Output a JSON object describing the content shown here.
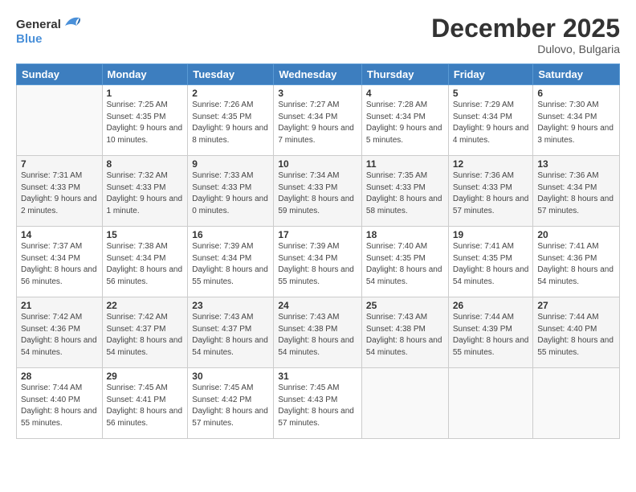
{
  "header": {
    "logo_general": "General",
    "logo_blue": "Blue",
    "month": "December 2025",
    "location": "Dulovo, Bulgaria"
  },
  "weekdays": [
    "Sunday",
    "Monday",
    "Tuesday",
    "Wednesday",
    "Thursday",
    "Friday",
    "Saturday"
  ],
  "weeks": [
    [
      {
        "day": "",
        "sunrise": "",
        "sunset": "",
        "daylight": ""
      },
      {
        "day": "1",
        "sunrise": "Sunrise: 7:25 AM",
        "sunset": "Sunset: 4:35 PM",
        "daylight": "Daylight: 9 hours and 10 minutes."
      },
      {
        "day": "2",
        "sunrise": "Sunrise: 7:26 AM",
        "sunset": "Sunset: 4:35 PM",
        "daylight": "Daylight: 9 hours and 8 minutes."
      },
      {
        "day": "3",
        "sunrise": "Sunrise: 7:27 AM",
        "sunset": "Sunset: 4:34 PM",
        "daylight": "Daylight: 9 hours and 7 minutes."
      },
      {
        "day": "4",
        "sunrise": "Sunrise: 7:28 AM",
        "sunset": "Sunset: 4:34 PM",
        "daylight": "Daylight: 9 hours and 5 minutes."
      },
      {
        "day": "5",
        "sunrise": "Sunrise: 7:29 AM",
        "sunset": "Sunset: 4:34 PM",
        "daylight": "Daylight: 9 hours and 4 minutes."
      },
      {
        "day": "6",
        "sunrise": "Sunrise: 7:30 AM",
        "sunset": "Sunset: 4:34 PM",
        "daylight": "Daylight: 9 hours and 3 minutes."
      }
    ],
    [
      {
        "day": "7",
        "sunrise": "Sunrise: 7:31 AM",
        "sunset": "Sunset: 4:33 PM",
        "daylight": "Daylight: 9 hours and 2 minutes."
      },
      {
        "day": "8",
        "sunrise": "Sunrise: 7:32 AM",
        "sunset": "Sunset: 4:33 PM",
        "daylight": "Daylight: 9 hours and 1 minute."
      },
      {
        "day": "9",
        "sunrise": "Sunrise: 7:33 AM",
        "sunset": "Sunset: 4:33 PM",
        "daylight": "Daylight: 9 hours and 0 minutes."
      },
      {
        "day": "10",
        "sunrise": "Sunrise: 7:34 AM",
        "sunset": "Sunset: 4:33 PM",
        "daylight": "Daylight: 8 hours and 59 minutes."
      },
      {
        "day": "11",
        "sunrise": "Sunrise: 7:35 AM",
        "sunset": "Sunset: 4:33 PM",
        "daylight": "Daylight: 8 hours and 58 minutes."
      },
      {
        "day": "12",
        "sunrise": "Sunrise: 7:36 AM",
        "sunset": "Sunset: 4:33 PM",
        "daylight": "Daylight: 8 hours and 57 minutes."
      },
      {
        "day": "13",
        "sunrise": "Sunrise: 7:36 AM",
        "sunset": "Sunset: 4:34 PM",
        "daylight": "Daylight: 8 hours and 57 minutes."
      }
    ],
    [
      {
        "day": "14",
        "sunrise": "Sunrise: 7:37 AM",
        "sunset": "Sunset: 4:34 PM",
        "daylight": "Daylight: 8 hours and 56 minutes."
      },
      {
        "day": "15",
        "sunrise": "Sunrise: 7:38 AM",
        "sunset": "Sunset: 4:34 PM",
        "daylight": "Daylight: 8 hours and 56 minutes."
      },
      {
        "day": "16",
        "sunrise": "Sunrise: 7:39 AM",
        "sunset": "Sunset: 4:34 PM",
        "daylight": "Daylight: 8 hours and 55 minutes."
      },
      {
        "day": "17",
        "sunrise": "Sunrise: 7:39 AM",
        "sunset": "Sunset: 4:34 PM",
        "daylight": "Daylight: 8 hours and 55 minutes."
      },
      {
        "day": "18",
        "sunrise": "Sunrise: 7:40 AM",
        "sunset": "Sunset: 4:35 PM",
        "daylight": "Daylight: 8 hours and 54 minutes."
      },
      {
        "day": "19",
        "sunrise": "Sunrise: 7:41 AM",
        "sunset": "Sunset: 4:35 PM",
        "daylight": "Daylight: 8 hours and 54 minutes."
      },
      {
        "day": "20",
        "sunrise": "Sunrise: 7:41 AM",
        "sunset": "Sunset: 4:36 PM",
        "daylight": "Daylight: 8 hours and 54 minutes."
      }
    ],
    [
      {
        "day": "21",
        "sunrise": "Sunrise: 7:42 AM",
        "sunset": "Sunset: 4:36 PM",
        "daylight": "Daylight: 8 hours and 54 minutes."
      },
      {
        "day": "22",
        "sunrise": "Sunrise: 7:42 AM",
        "sunset": "Sunset: 4:37 PM",
        "daylight": "Daylight: 8 hours and 54 minutes."
      },
      {
        "day": "23",
        "sunrise": "Sunrise: 7:43 AM",
        "sunset": "Sunset: 4:37 PM",
        "daylight": "Daylight: 8 hours and 54 minutes."
      },
      {
        "day": "24",
        "sunrise": "Sunrise: 7:43 AM",
        "sunset": "Sunset: 4:38 PM",
        "daylight": "Daylight: 8 hours and 54 minutes."
      },
      {
        "day": "25",
        "sunrise": "Sunrise: 7:43 AM",
        "sunset": "Sunset: 4:38 PM",
        "daylight": "Daylight: 8 hours and 54 minutes."
      },
      {
        "day": "26",
        "sunrise": "Sunrise: 7:44 AM",
        "sunset": "Sunset: 4:39 PM",
        "daylight": "Daylight: 8 hours and 55 minutes."
      },
      {
        "day": "27",
        "sunrise": "Sunrise: 7:44 AM",
        "sunset": "Sunset: 4:40 PM",
        "daylight": "Daylight: 8 hours and 55 minutes."
      }
    ],
    [
      {
        "day": "28",
        "sunrise": "Sunrise: 7:44 AM",
        "sunset": "Sunset: 4:40 PM",
        "daylight": "Daylight: 8 hours and 55 minutes."
      },
      {
        "day": "29",
        "sunrise": "Sunrise: 7:45 AM",
        "sunset": "Sunset: 4:41 PM",
        "daylight": "Daylight: 8 hours and 56 minutes."
      },
      {
        "day": "30",
        "sunrise": "Sunrise: 7:45 AM",
        "sunset": "Sunset: 4:42 PM",
        "daylight": "Daylight: 8 hours and 57 minutes."
      },
      {
        "day": "31",
        "sunrise": "Sunrise: 7:45 AM",
        "sunset": "Sunset: 4:43 PM",
        "daylight": "Daylight: 8 hours and 57 minutes."
      },
      {
        "day": "",
        "sunrise": "",
        "sunset": "",
        "daylight": ""
      },
      {
        "day": "",
        "sunrise": "",
        "sunset": "",
        "daylight": ""
      },
      {
        "day": "",
        "sunrise": "",
        "sunset": "",
        "daylight": ""
      }
    ]
  ]
}
